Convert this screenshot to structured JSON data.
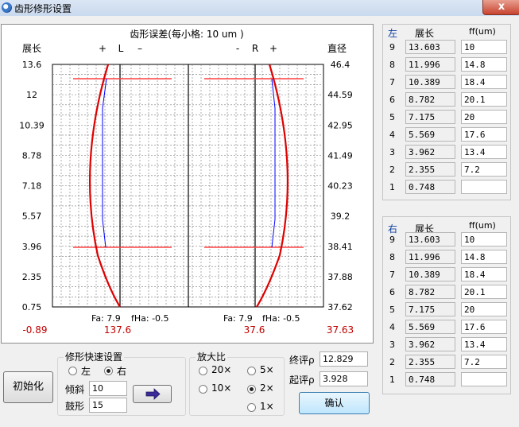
{
  "window": {
    "title": "齿形修形设置",
    "close_symbol": "x"
  },
  "chart": {
    "title": "齿形误差(每小格: 10 um )",
    "left_axis_title": "展长",
    "right_axis_title": "直径",
    "left_ticks": [
      "13.6",
      "12",
      "10.39",
      "8.78",
      "7.18",
      "5.57",
      "3.96",
      "2.35",
      "0.75"
    ],
    "right_ticks": [
      "46.4",
      "44.59",
      "42.95",
      "41.49",
      "40.23",
      "39.2",
      "38.41",
      "37.88",
      "37.62"
    ],
    "marker_plus": "+",
    "marker_minus": "-",
    "marker_minus_left": "–",
    "marker_L": "L",
    "marker_R": "R",
    "left_fa": "Fa: 7.9",
    "left_fha": "fHa: -0.5",
    "right_fa": "Fa: 7.9",
    "right_fha": "fHa: -0.5",
    "bottom_values": [
      "-0.89",
      "137.6",
      "37.6",
      "37.63"
    ],
    "colors": {
      "profile": "#e00000",
      "limit": "#ff4040",
      "design": "#0000ff",
      "grid": "#000000"
    }
  },
  "left_table": {
    "side": "左",
    "col1": "展长",
    "col2": "ff(um)",
    "rows": [
      {
        "idx": "9",
        "len": "13.603",
        "ff": "10"
      },
      {
        "idx": "8",
        "len": "11.996",
        "ff": "14.8"
      },
      {
        "idx": "7",
        "len": "10.389",
        "ff": "18.4"
      },
      {
        "idx": "6",
        "len": "8.782",
        "ff": "20.1"
      },
      {
        "idx": "5",
        "len": "7.175",
        "ff": "20"
      },
      {
        "idx": "4",
        "len": "5.569",
        "ff": "17.6"
      },
      {
        "idx": "3",
        "len": "3.962",
        "ff": "13.4"
      },
      {
        "idx": "2",
        "len": "2.355",
        "ff": "7.2"
      },
      {
        "idx": "1",
        "len": "0.748",
        "ff": ""
      }
    ]
  },
  "right_table": {
    "side": "右",
    "col1": "展长",
    "col2": "ff(um)",
    "rows": [
      {
        "idx": "9",
        "len": "13.603",
        "ff": "10"
      },
      {
        "idx": "8",
        "len": "11.996",
        "ff": "14.8"
      },
      {
        "idx": "7",
        "len": "10.389",
        "ff": "18.4"
      },
      {
        "idx": "6",
        "len": "8.782",
        "ff": "20.1"
      },
      {
        "idx": "5",
        "len": "7.175",
        "ff": "20"
      },
      {
        "idx": "4",
        "len": "5.569",
        "ff": "17.6"
      },
      {
        "idx": "3",
        "len": "3.962",
        "ff": "13.4"
      },
      {
        "idx": "2",
        "len": "2.355",
        "ff": "7.2"
      },
      {
        "idx": "1",
        "len": "0.748",
        "ff": ""
      }
    ]
  },
  "controls": {
    "init_button": "初始化",
    "quick_group_title": "修形快速设置",
    "side_left": "左",
    "side_right": "右",
    "selected_side": "右",
    "tilt_label": "倾斜",
    "tilt_value": "10",
    "crown_label": "鼓形",
    "crown_value": "15",
    "zoom_title": "放大比",
    "zoom_options": [
      "20×",
      "5×",
      "10×",
      "2×",
      "1×"
    ],
    "zoom_selected": "2×",
    "end_rho_label": "终评ρ",
    "end_rho_value": "12.829",
    "start_rho_label": "起评ρ",
    "start_rho_value": "3.928",
    "ok_button": "确认"
  }
}
